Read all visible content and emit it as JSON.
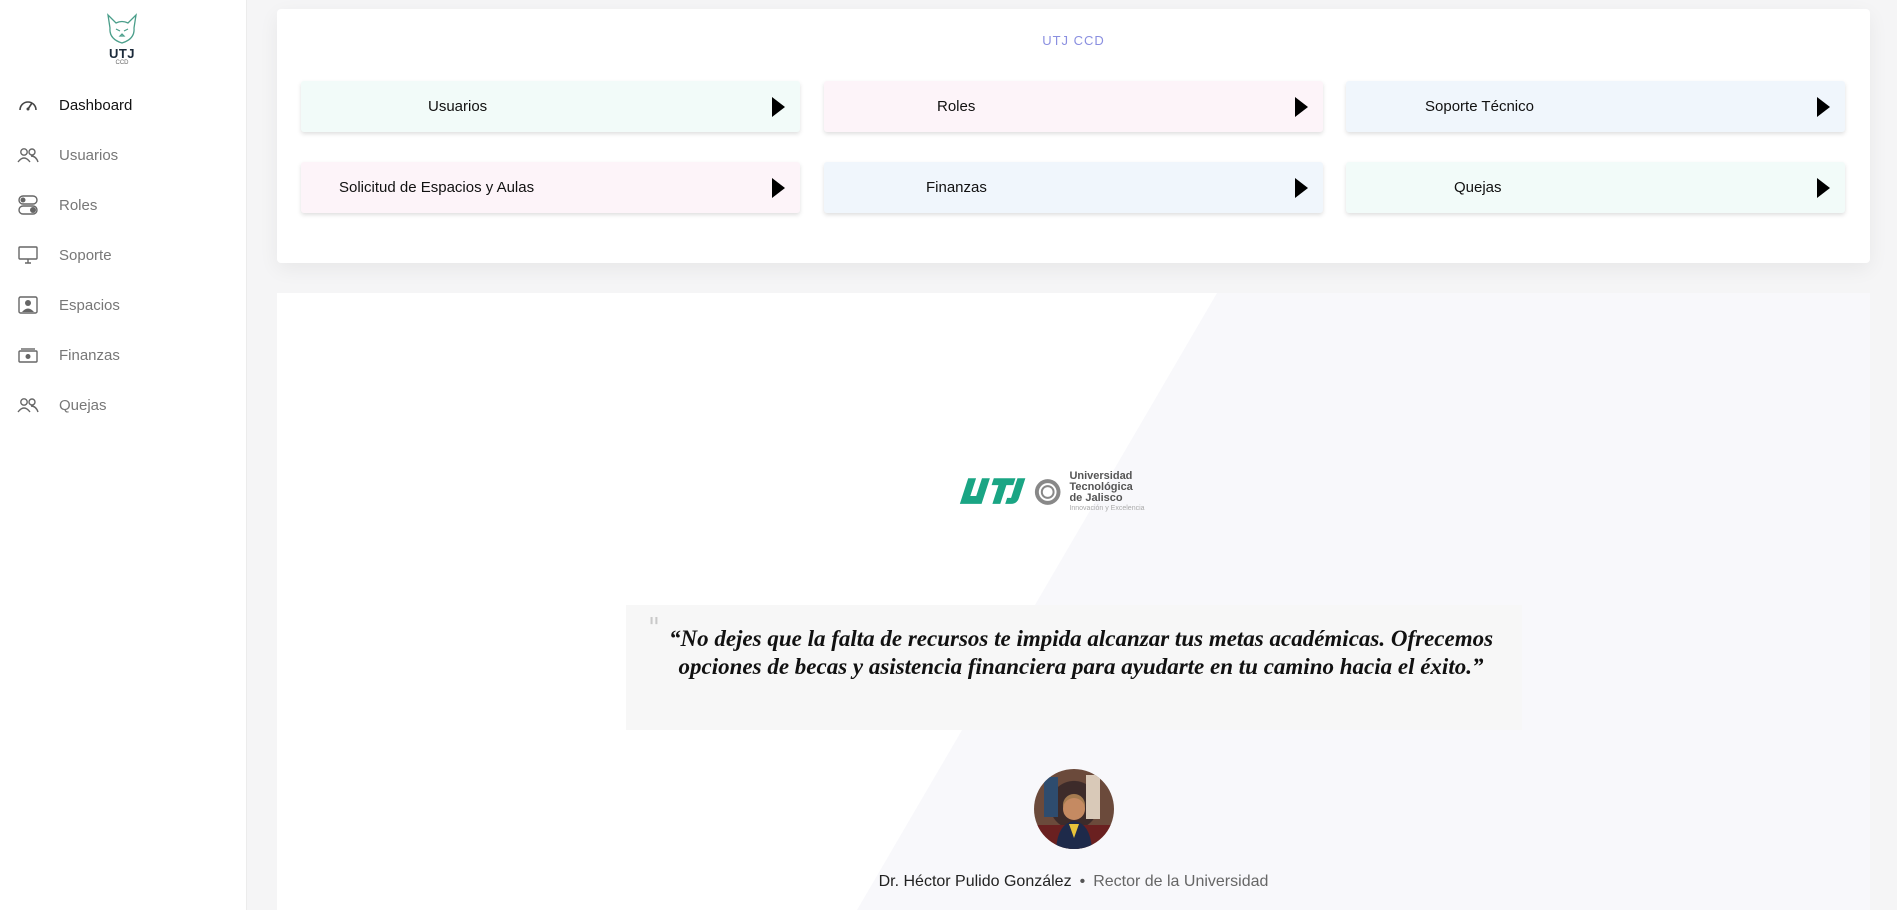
{
  "sidebar": {
    "brand": {
      "text": "UTJ",
      "sub": "CCD"
    },
    "items": [
      {
        "label": "Dashboard",
        "icon": "gauge-icon"
      },
      {
        "label": "Usuarios",
        "icon": "users-icon"
      },
      {
        "label": "Roles",
        "icon": "toggles-icon"
      },
      {
        "label": "Soporte",
        "icon": "monitor-icon"
      },
      {
        "label": "Espacios",
        "icon": "person-square-icon"
      },
      {
        "label": "Finanzas",
        "icon": "cash-icon"
      },
      {
        "label": "Quejas",
        "icon": "people-icon"
      }
    ]
  },
  "main": {
    "title": "UTJ CCD",
    "tiles": [
      {
        "label": "Usuarios"
      },
      {
        "label": "Roles"
      },
      {
        "label": "Soporte Técnico"
      },
      {
        "label": "Solicitud de Espacios y Aulas"
      },
      {
        "label": "Finanzas"
      },
      {
        "label": "Quejas"
      }
    ],
    "logo": {
      "line1": "Universidad Tecnológica",
      "line2": "de Jalisco",
      "line3": "Innovación y Excelencia"
    },
    "quote": {
      "mark": "\"",
      "text": "“No dejes que la falta de recursos te impida alcanzar tus metas académicas. Ofrecemos opciones de becas y asistencia financiera para ayudarte en tu camino hacia el éxito.”"
    },
    "author": {
      "name": "Dr. Héctor Pulido González",
      "separator": "•",
      "role": "Rector de la Universidad"
    }
  },
  "colors": {
    "accent": "#8a8fe0",
    "tile_mint": "#f2fbf9",
    "tile_pink": "#fdf4f9",
    "tile_blue": "#f0f6fc",
    "logo_green": "#1aa584"
  }
}
